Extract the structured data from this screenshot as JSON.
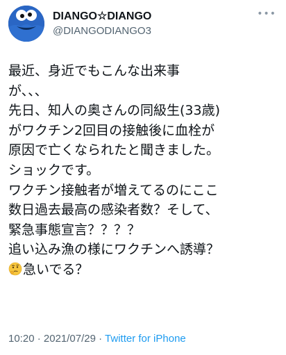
{
  "user": {
    "display_name": "DIANGO☆DIANGO",
    "handle": "@DIANGODIANGO3"
  },
  "tweet": {
    "lines": [
      "最近、身近でもこんな出来事",
      "が、、、",
      "先日、知人の奥さんの同級生(33歳)",
      "がワクチン2回目の接触後に血栓が",
      "原因で亡くなられたと聞きました。",
      "ショックです。",
      "ワクチン接触者が増えてるのにここ",
      "数日過去最高の感染者数？そして、",
      "緊急事態宣言？？？？",
      "追い込み漁の様にワクチンへ誘導？",
      "急いでる？"
    ],
    "last_line_emoji": "thinking-face-icon"
  },
  "meta": {
    "time": "10:20",
    "separator1": " · ",
    "date": "2021/07/29",
    "separator2": " · ",
    "source": "Twitter for iPhone"
  },
  "colors": {
    "text": "#0f1419",
    "secondary": "#536471",
    "link": "#1d9bf0",
    "avatar_blue": "#1d4e98"
  }
}
